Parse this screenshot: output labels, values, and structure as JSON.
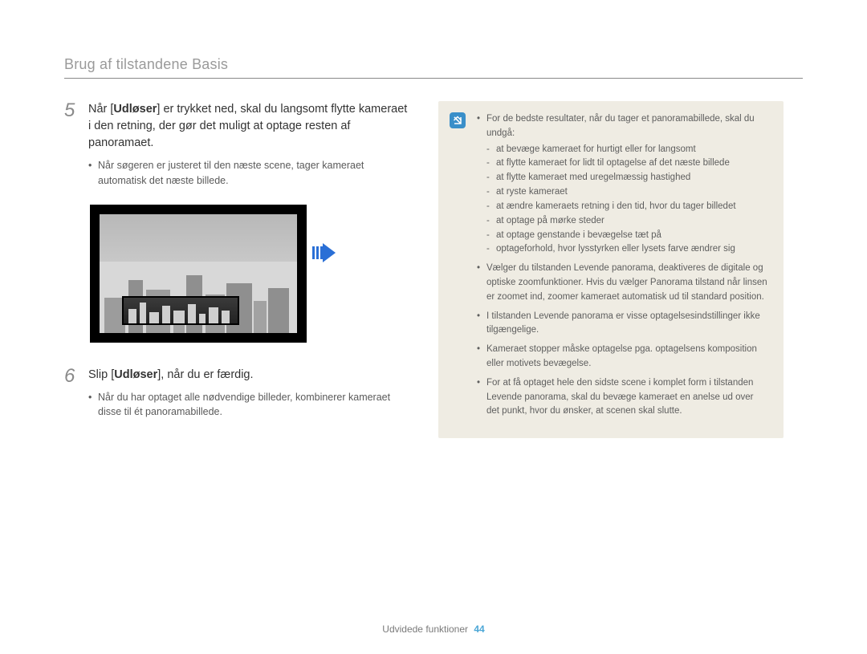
{
  "header": {
    "title": "Brug af tilstandene Basis"
  },
  "steps": {
    "s5": {
      "num": "5",
      "text_before": "Når [",
      "bold": "Udløser",
      "text_after": "] er trykket ned, skal du langsomt flytte kameraet i den retning, der gør det muligt at optage resten af panoramaet.",
      "bullet": "Når søgeren er justeret til den næste scene, tager kameraet automatisk det næste billede."
    },
    "s6": {
      "num": "6",
      "text_before": "Slip [",
      "bold": "Udløser",
      "text_after": "], når du er færdig.",
      "bullet": "Når du har optaget alle nødvendige billeder, kombinerer kameraet disse til ét panoramabillede."
    }
  },
  "info": {
    "intro": "For de bedste resultater, når du tager et panoramabillede, skal du undgå:",
    "dashes": [
      "at bevæge kameraet for hurtigt eller for langsomt",
      "at flytte kameraet for lidt til optagelse af det næste billede",
      "at flytte kameraet med uregelmæssig hastighed",
      "at ryste kameraet",
      "at ændre kameraets retning i den tid, hvor du tager billedet",
      "at optage på mørke steder",
      "at optage genstande i bevægelse tæt på",
      "optageforhold, hvor lysstyrken eller lysets farve ændrer sig"
    ],
    "bullets": [
      "Vælger du tilstanden Levende panorama, deaktiveres de digitale og optiske zoomfunktioner. Hvis du vælger Panorama tilstand når linsen er zoomet ind, zoomer kameraet automatisk ud til standard position.",
      "I tilstanden Levende panorama er visse optagelsesindstillinger ikke tilgængelige.",
      "Kameraet stopper måske optagelse pga. optagelsens komposition eller motivets bevægelse.",
      "For at få optaget hele den sidste scene i komplet form i tilstanden Levende panorama, skal du bevæge kameraet en anelse ud over det punkt, hvor du ønsker, at scenen skal slutte."
    ]
  },
  "footer": {
    "section": "Udvidede funktioner",
    "page": "44"
  }
}
